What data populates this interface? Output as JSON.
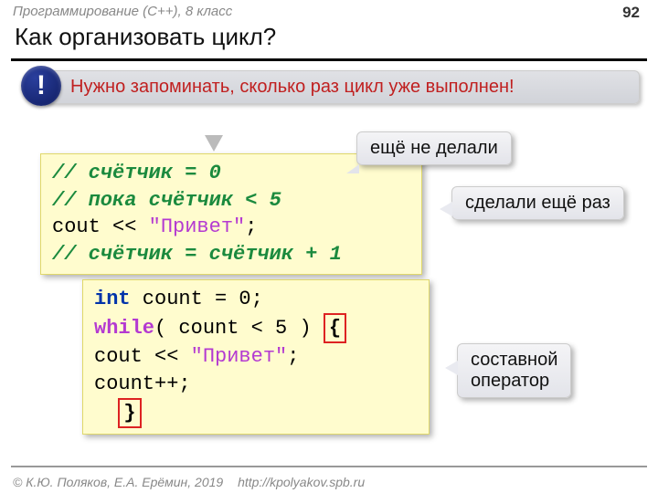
{
  "header": {
    "course": "Программирование (C++), 8 класс",
    "page": "92"
  },
  "title": "Как организовать цикл?",
  "callout": {
    "bang": "!",
    "text": "Нужно запоминать, сколько раз цикл уже выполнен!"
  },
  "code1": {
    "l1": "// счётчик = 0",
    "l2": "// пока счётчик < 5",
    "l3a": "  cout << ",
    "l3b": "\"Привет\"",
    "l3c": ";",
    "l4": "  // счётчик = счётчик + 1"
  },
  "code2": {
    "l1a": "int",
    "l1b": " count = 0;",
    "l2a": "while",
    "l2b": "( count < 5 ) ",
    "lbrace": "{",
    "l3a": "  cout << ",
    "l3b": "\"Привет\"",
    "l3c": ";",
    "l4": "  count++;",
    "rbrace": "}"
  },
  "bubbles": {
    "not_yet": "ещё не делали",
    "again": "сделали ещё раз",
    "compound1": "составной",
    "compound2": "оператор"
  },
  "footer": {
    "copyright": "© К.Ю. Поляков, Е.А. Ерёмин, 2019",
    "url": "http://kpolyakov.spb.ru"
  }
}
